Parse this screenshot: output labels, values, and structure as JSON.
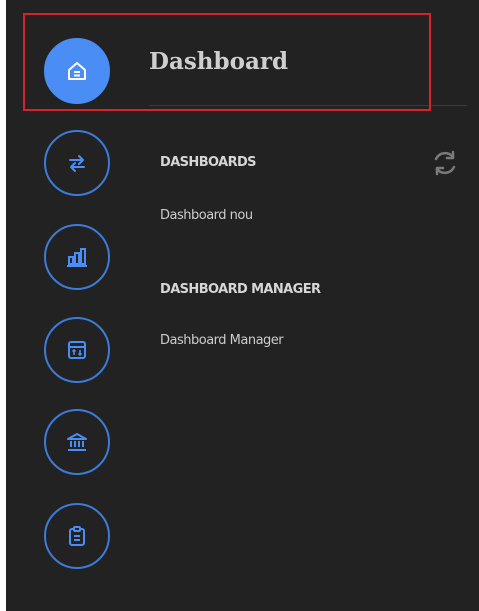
{
  "app": {
    "title": "Dashboard"
  },
  "rail": [
    {
      "icon": "home-icon",
      "active": true
    },
    {
      "icon": "transfer-arrows-icon",
      "active": false
    },
    {
      "icon": "bar-chart-icon",
      "active": false
    },
    {
      "icon": "calendar-sort-icon",
      "active": false
    },
    {
      "icon": "bank-icon",
      "active": false
    },
    {
      "icon": "clipboard-icon",
      "active": false
    }
  ],
  "menu": {
    "dashboards_heading": "DASHBOARDS",
    "dashboard_new": "Dashboard nou",
    "manager_heading": "DASHBOARD MANAGER",
    "manager_link": "Dashboard Manager"
  },
  "icons": {
    "refresh": "refresh-icon"
  },
  "colors": {
    "background": "#222222",
    "accent": "#4a8ef5",
    "ring": "#3d7bd9",
    "highlight": "#d9232b"
  }
}
